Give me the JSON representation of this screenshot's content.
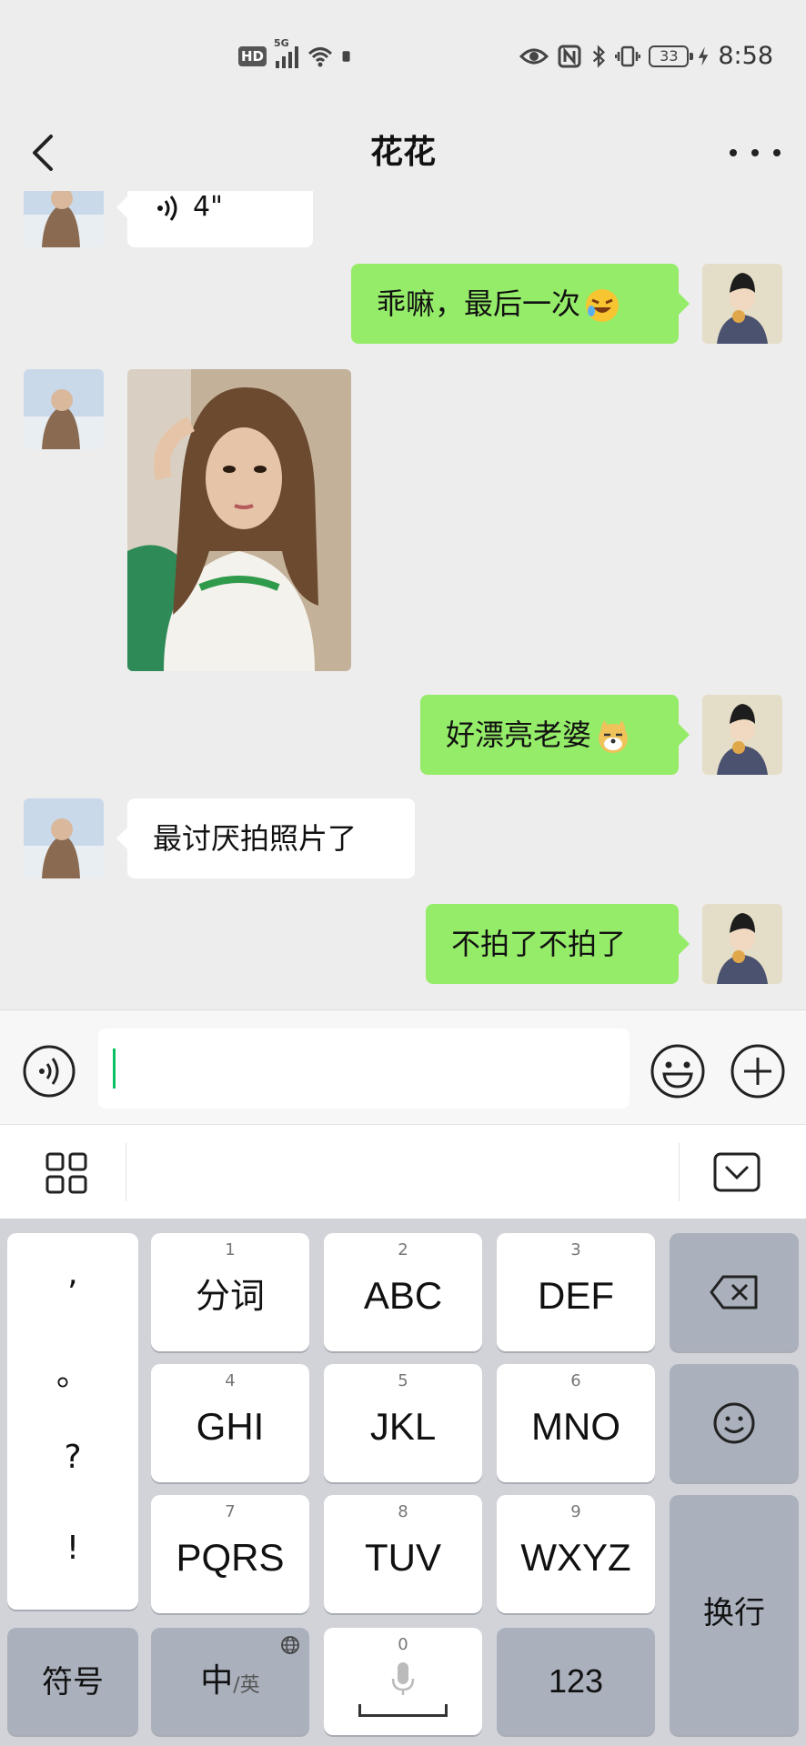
{
  "status_bar": {
    "hd": "HD",
    "network": "5G",
    "battery": "33",
    "time": "8:58"
  },
  "nav": {
    "title": "花花"
  },
  "messages": {
    "voice_duration": "4\"",
    "msg1": "乖嘛，最后一次",
    "msg2": "好漂亮老婆",
    "msg3": "最讨厌拍照片了",
    "msg4": "不拍了不拍了"
  },
  "keyboard": {
    "punct": [
      ",",
      "。",
      "?",
      "!"
    ],
    "keys": [
      {
        "num": "1",
        "label": "分词"
      },
      {
        "num": "2",
        "label": "ABC"
      },
      {
        "num": "3",
        "label": "DEF"
      },
      {
        "num": "4",
        "label": "GHI"
      },
      {
        "num": "5",
        "label": "JKL"
      },
      {
        "num": "6",
        "label": "MNO"
      },
      {
        "num": "7",
        "label": "PQRS"
      },
      {
        "num": "8",
        "label": "TUV"
      },
      {
        "num": "9",
        "label": "WXYZ"
      }
    ],
    "symbols": "符号",
    "lang_main": "中",
    "lang_alt": "/英",
    "space_num": "0",
    "num_mode": "123",
    "enter": "换行"
  }
}
